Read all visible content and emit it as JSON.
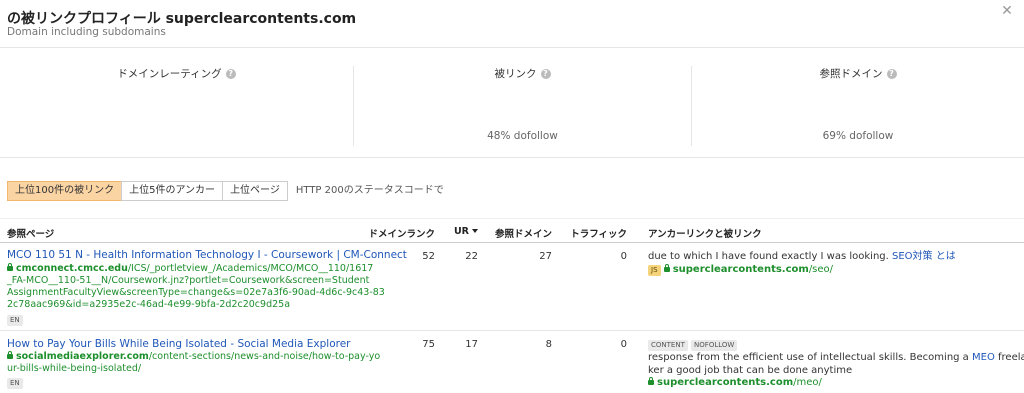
{
  "header": {
    "title": "の被リンクプロフィール superclearcontents.com",
    "subtitle": "Domain including subdomains",
    "close_icon": "close-icon"
  },
  "metrics": [
    {
      "label": "ドメインレーティング",
      "sub": ""
    },
    {
      "label": "被リンク",
      "sub": "48% dofollow"
    },
    {
      "label": "参照ドメイン",
      "sub": "69% dofollow"
    }
  ],
  "tabs": {
    "items": [
      "上位100件の被リンク",
      "上位5件のアンカー",
      "上位ページ"
    ],
    "active": 0,
    "note": "HTTP 200のステータスコードで"
  },
  "table": {
    "headers": {
      "ref_page": "参照ページ",
      "domain_rank": "ドメインランク",
      "ur": "UR",
      "ref_domains": "参照ドメイン",
      "traffic": "トラフィック",
      "anchor": "アンカーリンクと被リンク"
    },
    "rows": [
      {
        "title": "MCO 110 51 N - Health Information Technology I - Coursework | CM-Connect",
        "url_domain": "cmconnect.cmcc.edu",
        "url_rest_1": "/ICS/_portletview_/Academics/MCO/MCO__110/1617",
        "url_lines": [
          "_FA-MCO__110-51__N/Coursework.jnz?portlet=Coursework&screen=Student",
          "AssignmentFacultyView&screenType=change&s=02e7a3f6-90ad-4d6c-9c43-83",
          "2c78aac969&id=a2935e2c-46ad-4e99-9bfa-2d2c20c9d25a"
        ],
        "lang": "EN",
        "domain_rank": "52",
        "ur": "22",
        "ref_domains": "27",
        "traffic": "0",
        "badges": [],
        "anchor_before": "due to which I have found exactly I was looking.",
        "anchor_link": "SEO対策 とは",
        "anchor_after": "",
        "anchor_line2": "",
        "target_badge": "JS",
        "target_domain": "superclearcontents.com",
        "target_path": "/seo/"
      },
      {
        "title": "How to Pay Your Bills While Being Isolated - Social Media Explorer",
        "url_domain": "socialmediaexplorer.com",
        "url_rest_1": "/content-sections/news-and-noise/how-to-pay-yo",
        "url_lines": [
          "ur-bills-while-being-isolated/"
        ],
        "lang": "EN",
        "domain_rank": "75",
        "ur": "17",
        "ref_domains": "8",
        "traffic": "0",
        "badges": [
          "CONTENT",
          "NOFOLLOW"
        ],
        "anchor_before": "response from the efficient use of intellectual skills. Becoming a",
        "anchor_link": "MEO",
        "anchor_after": "freelance wor",
        "anchor_line2": "ker a good job that can be done anytime",
        "target_badge": "",
        "target_domain": "superclearcontents.com",
        "target_path": "/meo/"
      }
    ]
  }
}
